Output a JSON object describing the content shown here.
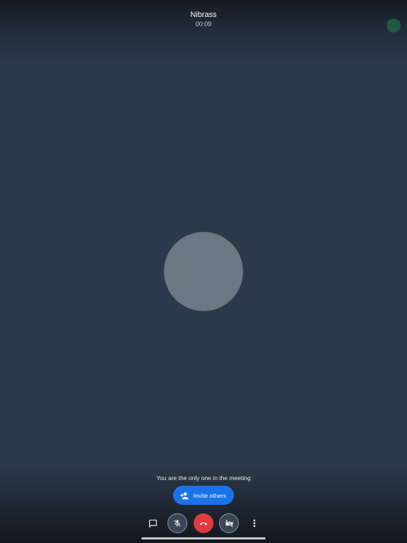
{
  "call": {
    "participant_name": "Nibrass",
    "elapsed_time": "00:09"
  },
  "meeting": {
    "status_message": "You are the only one in the meeting",
    "invite_label": "Invite others"
  },
  "controls": [
    {
      "name": "chat",
      "icon": "chat-icon"
    },
    {
      "name": "microphone",
      "icon": "mic-off-icon",
      "state": "muted"
    },
    {
      "name": "end-call",
      "icon": "hang-up-icon"
    },
    {
      "name": "camera",
      "icon": "camera-off-icon",
      "state": "off"
    },
    {
      "name": "more",
      "icon": "more-vertical-icon"
    }
  ],
  "colors": {
    "background": "#2c394b",
    "invite_button": "#1a73e8",
    "hangup_button": "#e03b3b",
    "avatar": "#6b7782"
  }
}
